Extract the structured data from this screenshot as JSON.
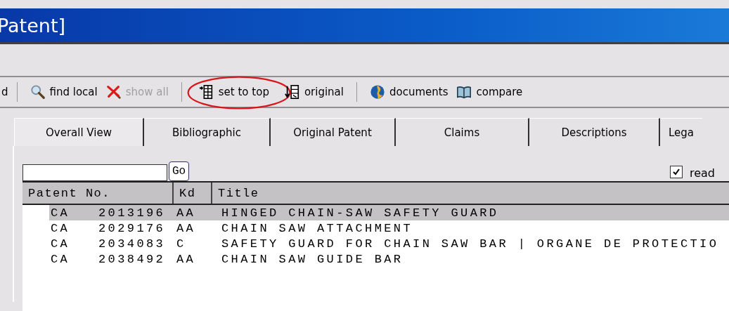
{
  "window": {
    "title": "Patent]"
  },
  "toolbar": [
    {
      "kind": "cut",
      "label": "d"
    },
    {
      "kind": "sep"
    },
    {
      "kind": "tool",
      "label": "find local",
      "disabled": false,
      "highlighted": false
    },
    {
      "kind": "tool",
      "label": "show all",
      "disabled": true,
      "highlighted": false
    },
    {
      "kind": "sep"
    },
    {
      "kind": "tool",
      "label": "set to top",
      "disabled": false,
      "highlighted": true
    },
    {
      "kind": "tool",
      "label": "original",
      "disabled": false,
      "highlighted": false
    },
    {
      "kind": "sep"
    },
    {
      "kind": "tool",
      "label": "documents",
      "disabled": false,
      "highlighted": false
    },
    {
      "kind": "tool",
      "label": "compare",
      "disabled": false,
      "highlighted": false
    }
  ],
  "tabs": [
    {
      "label": "Overall View",
      "selected": true
    },
    {
      "label": "Bibliographic",
      "selected": false
    },
    {
      "label": "Original Patent",
      "selected": false
    },
    {
      "label": "Claims",
      "selected": false
    },
    {
      "label": "Descriptions",
      "selected": false
    },
    {
      "label": "Lega",
      "selected": false
    }
  ],
  "search": {
    "button": "Go"
  },
  "read_filter": {
    "label": "read",
    "checked": true
  },
  "table": {
    "columns": [
      "Patent No.",
      "Kd",
      "Title"
    ],
    "rows": [
      {
        "country": "CA",
        "number": "2013196",
        "kd": "AA",
        "title": "HINGED CHAIN-SAW SAFETY GUARD",
        "selected": true
      },
      {
        "country": "CA",
        "number": "2029176",
        "kd": "AA",
        "title": "CHAIN SAW ATTACHMENT",
        "selected": false
      },
      {
        "country": "CA",
        "number": "2034083",
        "kd": "C",
        "title": "SAFETY GUARD FOR CHAIN SAW BAR | ORGANE DE PROTECTIO",
        "selected": false
      },
      {
        "country": "CA",
        "number": "2038492",
        "kd": "AA",
        "title": "CHAIN SAW GUIDE BAR",
        "selected": false
      }
    ]
  }
}
